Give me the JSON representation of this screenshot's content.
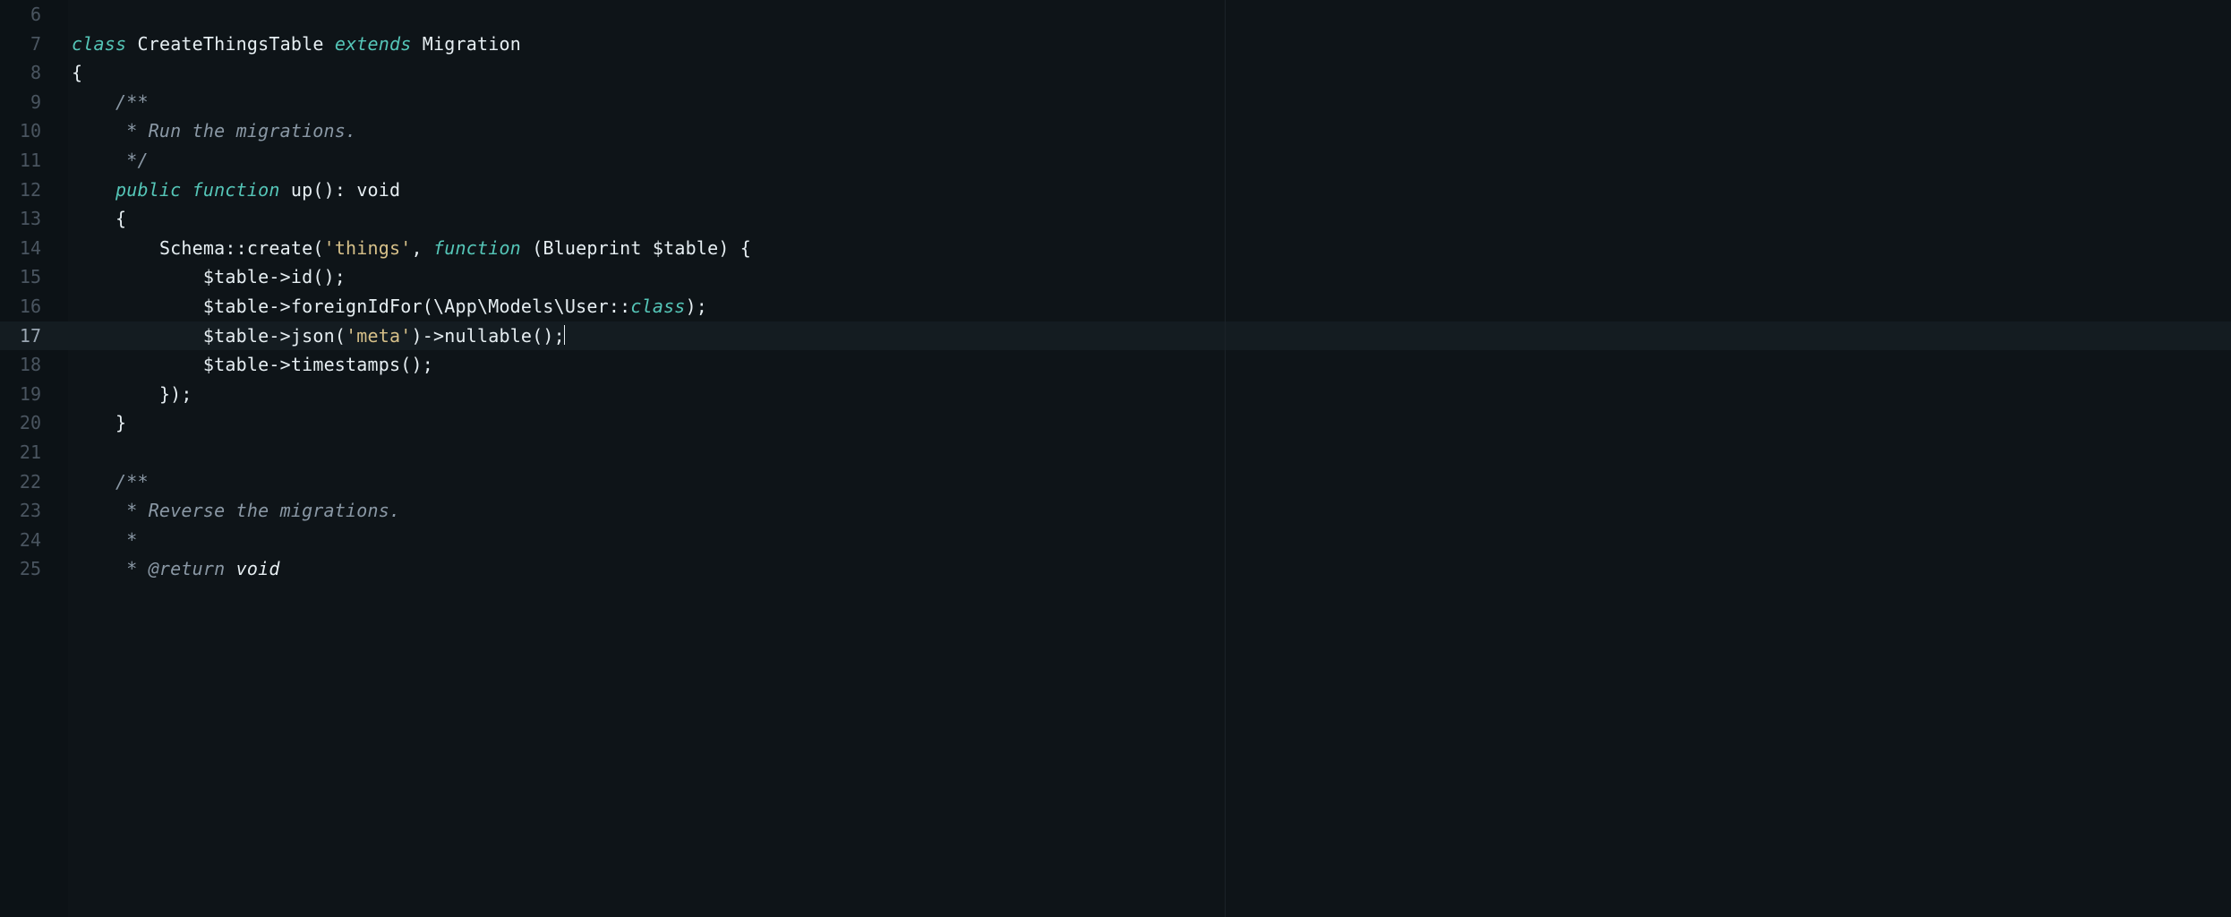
{
  "active_line_index": 11,
  "line_numbers": [
    "6",
    "7",
    "8",
    "9",
    "10",
    "11",
    "12",
    "13",
    "14",
    "15",
    "16",
    "17",
    "18",
    "19",
    "20",
    "21",
    "22",
    "23",
    "24",
    "25"
  ],
  "code": {
    "l6": {
      "blank": ""
    },
    "l7": {
      "kw_class": "class",
      "name": "CreateThingsTable",
      "kw_extends": "extends",
      "base": "Migration"
    },
    "l8": {
      "brace_open": "{"
    },
    "l9": {
      "c": "/**"
    },
    "l10": {
      "c": " * Run the migrations."
    },
    "l11": {
      "c": " */"
    },
    "l12": {
      "kw_public": "public",
      "kw_function": "function",
      "fn": "up",
      "parens": "()",
      "colon_type": ": ",
      "ret": "void"
    },
    "l13": {
      "brace_open": "{"
    },
    "l14": {
      "schema": "Schema",
      "dbl": "::",
      "create": "create",
      "open": "(",
      "str": "'things'",
      "comma": ", ",
      "kw_function": "function",
      "sp": " ",
      "paramo": "(",
      "bp": "Blueprint ",
      "tbl": "$table",
      "paramc": ")",
      "ob": " {"
    },
    "l15": {
      "t": "$table->",
      "fn": "id",
      "rest": "();"
    },
    "l16": {
      "t": "$table->",
      "fn": "foreignIdFor",
      "open": "(",
      "ns": "\\App\\Models\\User::",
      "cls": "class",
      "close": ");"
    },
    "l17": {
      "t": "$table->",
      "fn": "json",
      "open": "(",
      "str": "'meta'",
      "mid": ")->",
      "fn2": "nullable",
      "rest": "();"
    },
    "l18": {
      "t": "$table->",
      "fn": "timestamps",
      "rest": "();"
    },
    "l19": {
      "close": "});"
    },
    "l20": {
      "brace_close": "}"
    },
    "l21": {
      "blank": ""
    },
    "l22": {
      "c": "/**"
    },
    "l23": {
      "c": " * Reverse the migrations."
    },
    "l24": {
      "c": " *"
    },
    "l25": {
      "c": " * @return ",
      "ret": "void"
    }
  }
}
